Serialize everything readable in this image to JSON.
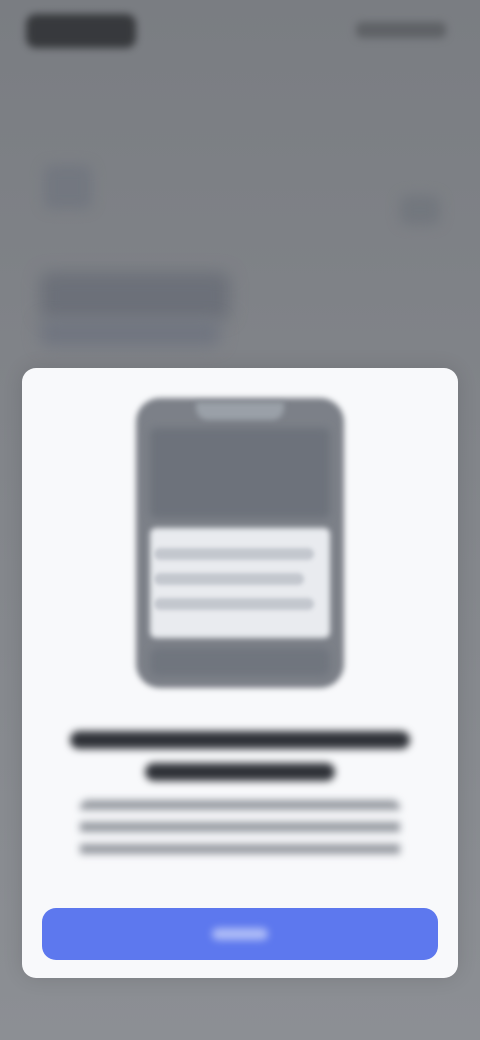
{
  "status_bar": {
    "time": "",
    "icons": [
      "signal-icon",
      "wifi-icon",
      "battery-icon"
    ]
  },
  "background_page": {
    "title": "",
    "subtitle": ""
  },
  "modal": {
    "title": "",
    "body": "",
    "primary_button_label": "",
    "colors": {
      "button": "#5d78ee",
      "card": "#f8f9fb",
      "scrim": "#7e8186"
    }
  }
}
